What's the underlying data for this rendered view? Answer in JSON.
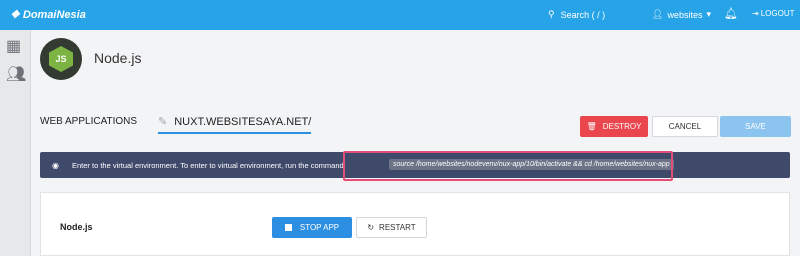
{
  "topbar": {
    "brand": "DomaiNesia",
    "search_label": "Search ( / )",
    "user_label": "websites",
    "logout_label": "LOGOUT"
  },
  "app": {
    "name": "Node.js",
    "logo_text": "JS"
  },
  "section": {
    "label": "WEB APPLICATIONS",
    "domain": "NUXT.WEBSITESAYA.NET/"
  },
  "actions": {
    "destroy": "DESTROY",
    "cancel": "CANCEL",
    "save": "SAVE"
  },
  "notice": {
    "text": "Enter to the virtual environment. To enter to virtual environment, run the command:",
    "command": "source /home/websites/nodevenv/nux-app/10/bin/activate && cd /home/websites/nux-app"
  },
  "panel": {
    "label": "Node.js",
    "stop": "STOP APP",
    "restart": "RESTART"
  },
  "colors": {
    "topbar": "#27a4e8",
    "destroy": "#e9464d",
    "primary": "#2c8fe2",
    "notice": "#3f4a6b",
    "highlight": "#e24d7a"
  }
}
